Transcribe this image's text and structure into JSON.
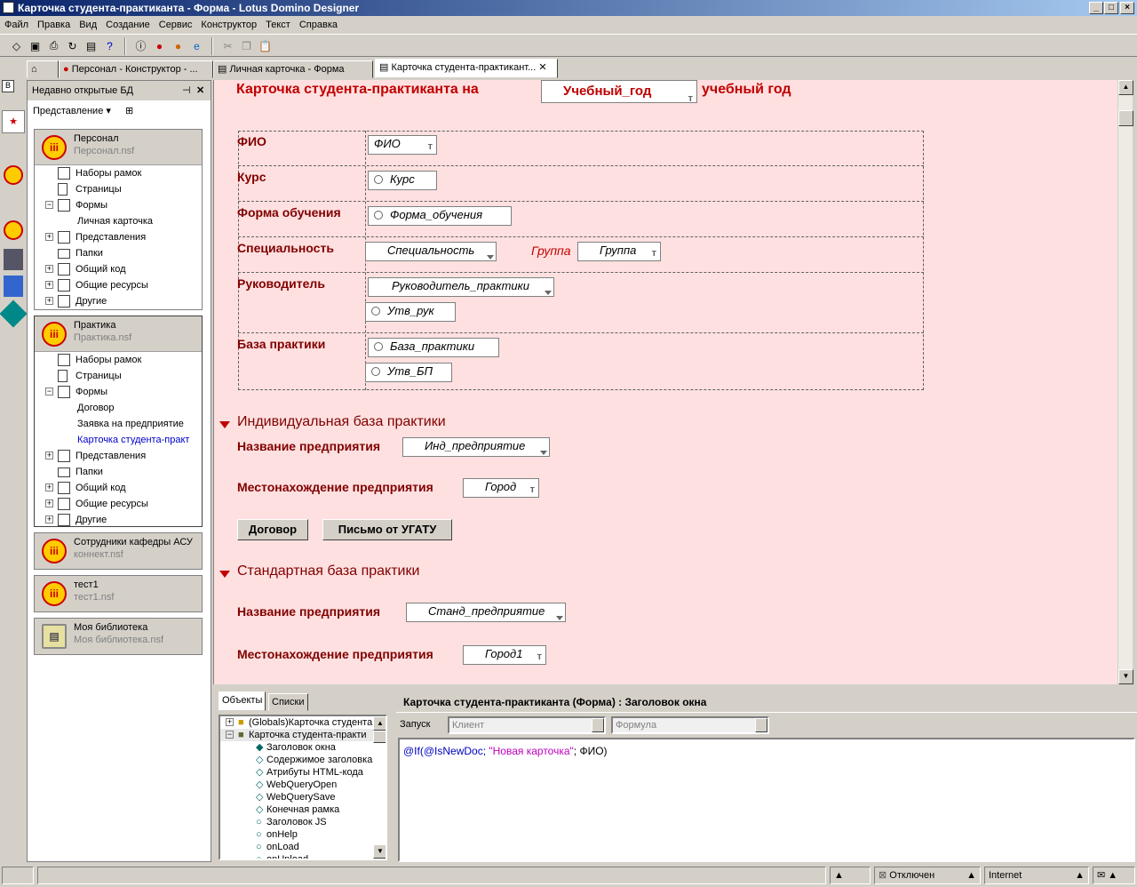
{
  "window": {
    "title": "Карточка студента-практиканта - Форма - Lotus Domino Designer"
  },
  "menu": [
    "Файл",
    "Правка",
    "Вид",
    "Создание",
    "Сервис",
    "Конструктор",
    "Текст",
    "Справка"
  ],
  "tabs": [
    {
      "label": "Персонал - Конструктор - ..."
    },
    {
      "label": "Личная карточка - Форма"
    },
    {
      "label": "Карточка студента-практикант..."
    }
  ],
  "nav": {
    "header": "Недавно открытые БД",
    "view_label": "Представление",
    "dbs": [
      {
        "name": "Персонал",
        "file": "Персонал.nsf",
        "items": [
          "Наборы рамок",
          "Страницы",
          "Формы",
          "Личная карточка",
          "Представления",
          "Папки",
          "Общий код",
          "Общие ресурсы",
          "Другие"
        ]
      },
      {
        "name": "Практика",
        "file": "Практика.nsf",
        "items": [
          "Наборы рамок",
          "Страницы",
          "Формы",
          "Договор",
          "Заявка на предприятие",
          "Карточка студента-практ",
          "Представления",
          "Папки",
          "Общий код",
          "Общие ресурсы",
          "Другие"
        ]
      },
      {
        "name": "Сотрудники кафедры АСУ",
        "file": "коннект.nsf"
      },
      {
        "name": "тест1",
        "file": "тест1.nsf"
      },
      {
        "name": "Моя библиотека",
        "file": "Моя библиотека.nsf"
      }
    ]
  },
  "form": {
    "title_prefix": "Карточка студента-практиканта на",
    "title_field": "Учебный_год",
    "title_suffix": "учебный год",
    "labels": {
      "fio": "ФИО",
      "kurs": "Курс",
      "forma": "Форма обучения",
      "spec": "Специальность",
      "group": "Группа",
      "ruk": "Руководитель",
      "baza": "База практики"
    },
    "fields": {
      "fio": "ФИО",
      "kurs": "Курс",
      "forma": "Форма_обучения",
      "spec": "Специальность",
      "group": "Группа",
      "ruk": "Руководитель_практики",
      "utv_ruk": "Утв_рук",
      "baza": "База_практики",
      "utv_bp": "Утв_БП"
    },
    "section1": {
      "title": "Индивидуальная база практики",
      "name_label": "Название предприятия",
      "name_field": "Инд_предприятие",
      "loc_label": "Местонахождение предприятия",
      "loc_field": "Город"
    },
    "buttons": [
      "Договор",
      "Письмо от УГАТУ"
    ],
    "section2": {
      "title": "Стандартная база практики",
      "name_label": "Название предприятия",
      "name_field": "Станд_предприятие",
      "loc_label": "Местонахождение предприятия",
      "loc_field": "Город1"
    },
    "type_marker": "т"
  },
  "objects": {
    "tabs": [
      "Объекты",
      "Списки"
    ],
    "items": [
      "(Globals)Карточка студента",
      "Карточка студента-практи",
      "Заголовок окна",
      "Содержимое заголовка",
      "Атрибуты HTML-кода",
      "WebQueryOpen",
      "WebQuerySave",
      "Конечная рамка",
      "Заголовок JS",
      "onHelp",
      "onLoad",
      "onUnload"
    ]
  },
  "code": {
    "header": "Карточка студента-практиканта (Форма) : Заголовок окна",
    "run_label": "Запуск",
    "run_value": "Клиент",
    "type_value": "Формула",
    "formula_fn": "@If(@IsNewDoc; ",
    "formula_str": "\"Новая карточка\"",
    "formula_rest": "; ФИО)"
  },
  "status": {
    "connection": "Отключен",
    "location": "Internet"
  },
  "colors": {
    "form_bg": "#ffe0e0",
    "label": "#800000",
    "title": "#c00000",
    "formula_fn": "#0000c0",
    "formula_str": "#c000c0"
  }
}
